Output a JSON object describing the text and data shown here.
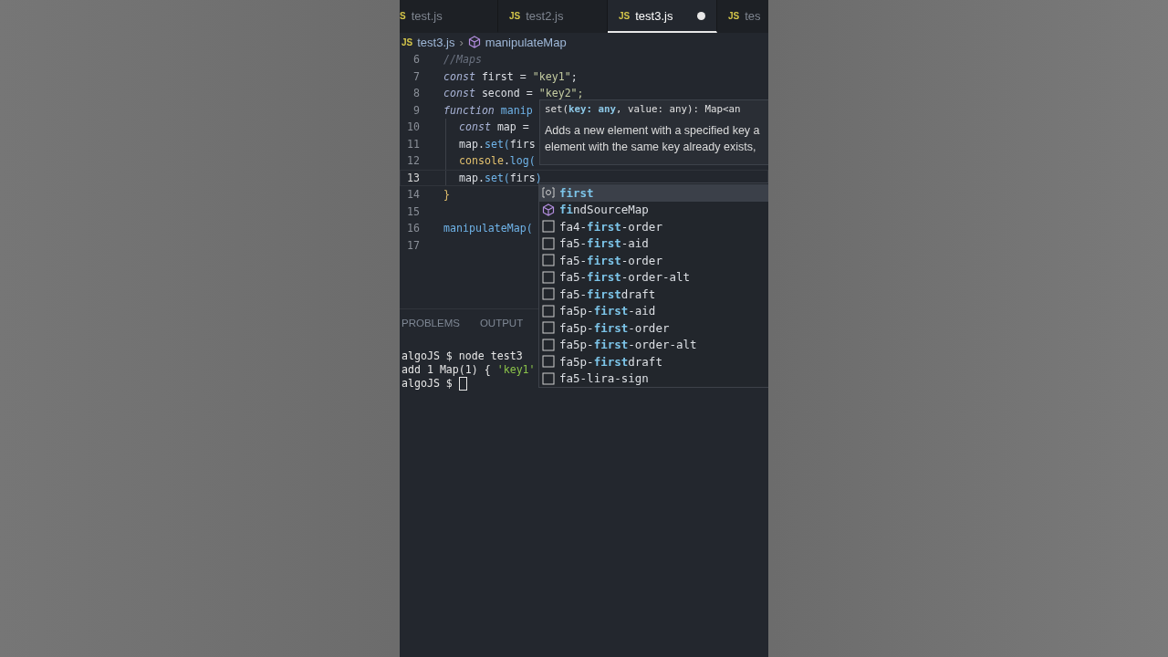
{
  "tabs": [
    {
      "icon": "S",
      "label": "test.js",
      "selected": false,
      "modified": false
    },
    {
      "icon": "JS",
      "label": "test2.js",
      "selected": false,
      "modified": false
    },
    {
      "icon": "JS",
      "label": "test3.js",
      "selected": true,
      "modified": true
    },
    {
      "icon": "JS",
      "label": "tes",
      "selected": false,
      "modified": false
    }
  ],
  "breadcrumb": {
    "file_icon": "JS",
    "file": "test3.js",
    "separator": "›",
    "symbol": "manipulateMap"
  },
  "code_lines": [
    {
      "number": "6",
      "nested": false,
      "current": false,
      "tokens": [
        {
          "kind": "comment",
          "text": "//Maps"
        }
      ]
    },
    {
      "number": "7",
      "nested": false,
      "current": false,
      "tokens": [
        {
          "kind": "keyword",
          "text": "const"
        },
        {
          "kind": "plain",
          "text": " first = "
        },
        {
          "kind": "string",
          "text": "\"key1\""
        },
        {
          "kind": "plain",
          "text": ";"
        }
      ]
    },
    {
      "number": "8",
      "nested": false,
      "current": false,
      "tokens": [
        {
          "kind": "keyword",
          "text": "const"
        },
        {
          "kind": "plain",
          "text": " second = "
        },
        {
          "kind": "string",
          "text": "\"key2\";"
        }
      ]
    },
    {
      "number": "9",
      "nested": false,
      "current": false,
      "tokens": [
        {
          "kind": "keyword",
          "text": "function"
        },
        {
          "kind": "function",
          "text": " manip"
        }
      ]
    },
    {
      "number": "10",
      "nested": true,
      "current": false,
      "tokens": [
        {
          "kind": "keyword",
          "text": "const"
        },
        {
          "kind": "plain",
          "text": " map ="
        }
      ]
    },
    {
      "number": "11",
      "nested": true,
      "current": false,
      "tokens": [
        {
          "kind": "plain",
          "text": "map."
        },
        {
          "kind": "function",
          "text": "set("
        },
        {
          "kind": "plain",
          "text": "firs"
        }
      ]
    },
    {
      "number": "12",
      "nested": true,
      "current": false,
      "tokens": [
        {
          "kind": "object",
          "text": "console"
        },
        {
          "kind": "plain",
          "text": "."
        },
        {
          "kind": "function",
          "text": "log("
        }
      ]
    },
    {
      "number": "13",
      "nested": true,
      "current": true,
      "tokens": [
        {
          "kind": "plain",
          "text": "map."
        },
        {
          "kind": "function",
          "text": "set("
        },
        {
          "kind": "plain",
          "text": "firs"
        },
        {
          "kind": "function",
          "text": ")"
        }
      ]
    },
    {
      "number": "14",
      "nested": false,
      "current": false,
      "tokens": [
        {
          "kind": "object",
          "text": "}"
        }
      ]
    },
    {
      "number": "15",
      "nested": false,
      "current": false
    },
    {
      "number": "16",
      "nested": false,
      "current": false,
      "tokens": [
        {
          "kind": "function",
          "text": "manipulateMap("
        }
      ]
    },
    {
      "number": "17",
      "nested": false,
      "current": false
    }
  ],
  "hover": {
    "signature": "set(**key: any**, value: any): Map<an",
    "doc": [
      "Adds a new element with a specified key a",
      "element with the same key already exists,"
    ]
  },
  "suggestions": [
    {
      "kind": "variable",
      "label": "**first**",
      "selected": true
    },
    {
      "kind": "module",
      "label": "**fi**ndSourceMap",
      "selected": false
    },
    {
      "kind": "text",
      "label": "fa4-**first**-order",
      "selected": false
    },
    {
      "kind": "text",
      "label": "fa5-**first**-aid",
      "selected": false
    },
    {
      "kind": "text",
      "label": "fa5-**first**-order",
      "selected": false
    },
    {
      "kind": "text",
      "label": "fa5-**first**-order-alt",
      "selected": false
    },
    {
      "kind": "text",
      "label": "fa5-**first**draft",
      "selected": false
    },
    {
      "kind": "text",
      "label": "fa5p-**first**-aid",
      "selected": false
    },
    {
      "kind": "text",
      "label": "fa5p-**first**-order",
      "selected": false
    },
    {
      "kind": "text",
      "label": "fa5p-**first**-order-alt",
      "selected": false
    },
    {
      "kind": "text",
      "label": "fa5p-**first**draft",
      "selected": false
    },
    {
      "kind": "text",
      "label": "fa5-lira-sign",
      "selected": false
    }
  ],
  "panel_tabs": [
    {
      "label": "PROBLEMS",
      "selected": false
    },
    {
      "label": "OUTPUT",
      "selected": false
    }
  ],
  "terminal": [
    {
      "cursor": false,
      "parts": [
        {
          "kind": "plain",
          "text": "algoJS $ node test3"
        }
      ]
    },
    {
      "cursor": false,
      "parts": [
        {
          "kind": "plain",
          "text": "add 1 Map(1) { "
        },
        {
          "kind": "string",
          "text": "'key1'"
        }
      ]
    },
    {
      "cursor": true,
      "parts": [
        {
          "kind": "plain",
          "text": "algoJS $ "
        }
      ]
    }
  ]
}
